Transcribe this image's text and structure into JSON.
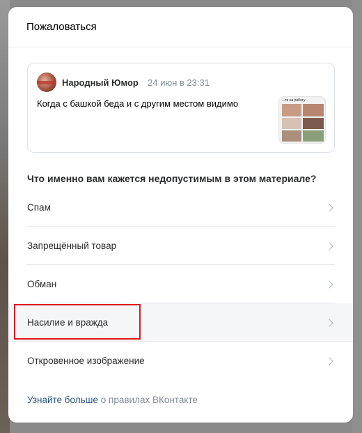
{
  "modal": {
    "title": "Пожаловаться"
  },
  "post": {
    "author": "Народный Юмор",
    "date": "24 июн в 23:31",
    "text": "Когда с башкой беда и с другим местом видимо",
    "thumbnail_caption": "...ти на работу"
  },
  "question": "Что именно вам кажется недопустимым в этом материале?",
  "options": [
    {
      "label": "Спам"
    },
    {
      "label": "Запрещённый товар"
    },
    {
      "label": "Обман"
    },
    {
      "label": "Насилие и вражда"
    },
    {
      "label": "Откровенное изображение"
    }
  ],
  "footer": {
    "link": "Узнайте больше",
    "rest": "о правилах ВКонтакте"
  },
  "colors": {
    "link": "#2a5885",
    "secondary_text": "#818c99",
    "highlight": "#e0161c",
    "hover_row": "#f5f6f8"
  }
}
